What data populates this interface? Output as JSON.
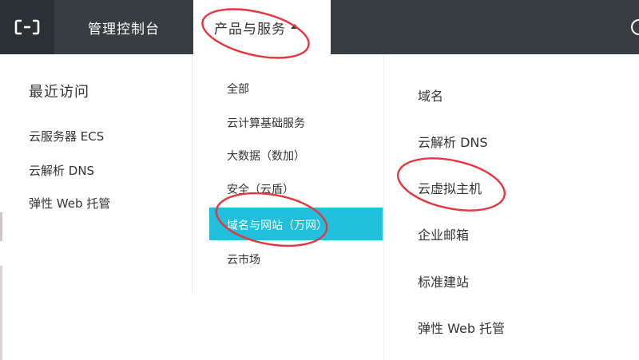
{
  "topbar": {
    "logo_icon": "aliyun-logo-icon",
    "console_label": "管理控制台",
    "products_label": "产品与服务"
  },
  "recent": {
    "heading": "最近访问",
    "items": [
      "云服务器 ECS",
      "云解析 DNS",
      "弹性 Web 托管"
    ]
  },
  "categories": {
    "items": [
      "全部",
      "云计算基础服务",
      "大数据（数加）",
      "安全（云盾）",
      "域名与网站（万网）",
      "云市场"
    ],
    "active": "域名与网站（万网）"
  },
  "services": {
    "items": [
      "域名",
      "云解析 DNS",
      "云虚拟主机",
      "企业邮箱",
      "标准建站",
      "弹性 Web 托管"
    ]
  },
  "colors": {
    "topbar_bg": "#373d41",
    "logo_bg": "#2b3034",
    "active_bg": "#20bfdc",
    "annotation": "#e8343d"
  }
}
